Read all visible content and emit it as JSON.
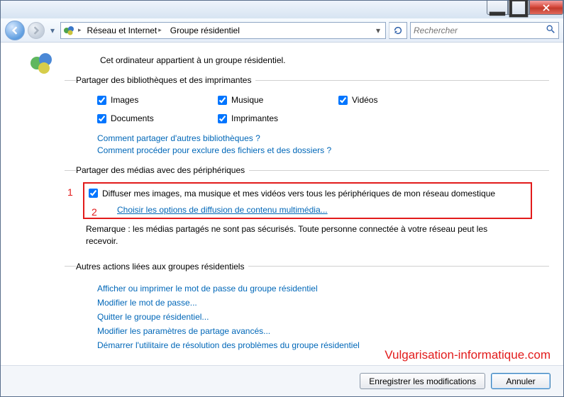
{
  "breadcrumb": {
    "item1": "Réseau et Internet",
    "item2": "Groupe résidentiel"
  },
  "search": {
    "placeholder": "Rechercher"
  },
  "intro": "Cet ordinateur appartient à un groupe résidentiel.",
  "section_libraries": {
    "legend": "Partager des bibliothèques et des imprimantes",
    "items": {
      "images": "Images",
      "musique": "Musique",
      "videos": "Vidéos",
      "documents": "Documents",
      "imprimantes": "Imprimantes"
    },
    "link1": "Comment partager d'autres bibliothèques ?",
    "link2": "Comment procéder pour exclure des fichiers et des dossiers ?"
  },
  "section_media": {
    "legend": "Partager des médias avec des périphériques",
    "marker1": "1",
    "marker2": "2",
    "stream_label": "Diffuser mes images, ma musique et mes vidéos vers tous les périphériques de mon réseau domestique",
    "options_link": "Choisir les options de diffusion de contenu multimédia...",
    "note": "Remarque : les médias partagés ne sont pas sécurisés. Toute personne connectée à votre réseau peut les recevoir."
  },
  "section_actions": {
    "legend": "Autres actions liées aux groupes résidentiels",
    "links": {
      "a1": "Afficher ou imprimer le mot de passe du groupe résidentiel",
      "a2": "Modifier le mot de passe...",
      "a3": "Quitter le groupe résidentiel...",
      "a4": "Modifier les paramètres de partage avancés...",
      "a5": "Démarrer l'utilitaire de résolution des problèmes du groupe résidentiel"
    }
  },
  "footer": {
    "save": "Enregistrer les modifications",
    "cancel": "Annuler"
  },
  "watermark": "Vulgarisation-informatique.com"
}
